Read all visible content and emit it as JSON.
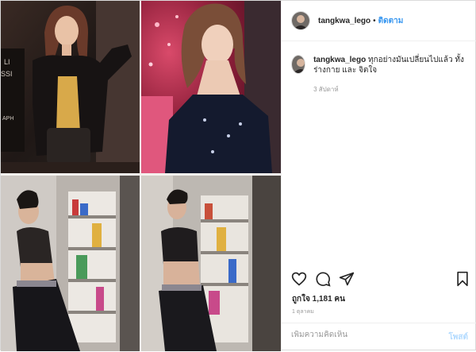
{
  "post": {
    "username": "tangkwa_lego",
    "separator": "•",
    "follow_label": "ติดตาม"
  },
  "caption": {
    "username": "tangkwa_lego",
    "text": "ทุกอย่างมันเปลี่ยนไปแล้ว ทั้งร่างกาย และ จิตใจ",
    "time": "3 สัปดาห์"
  },
  "stats": {
    "likes": "ถูกใจ 1,181 คน",
    "date": "1 ตุลาคม"
  },
  "comment": {
    "placeholder": "เพิ่มความคิดเห็น",
    "post_label": "โพสต์"
  },
  "icons": {
    "like": "heart-icon",
    "comment": "comment-icon",
    "share": "share-icon",
    "save": "bookmark-icon"
  },
  "colors": {
    "follow": "#3897f0",
    "post_disabled": "#b3dbff",
    "text": "#262626",
    "muted": "#999999"
  }
}
